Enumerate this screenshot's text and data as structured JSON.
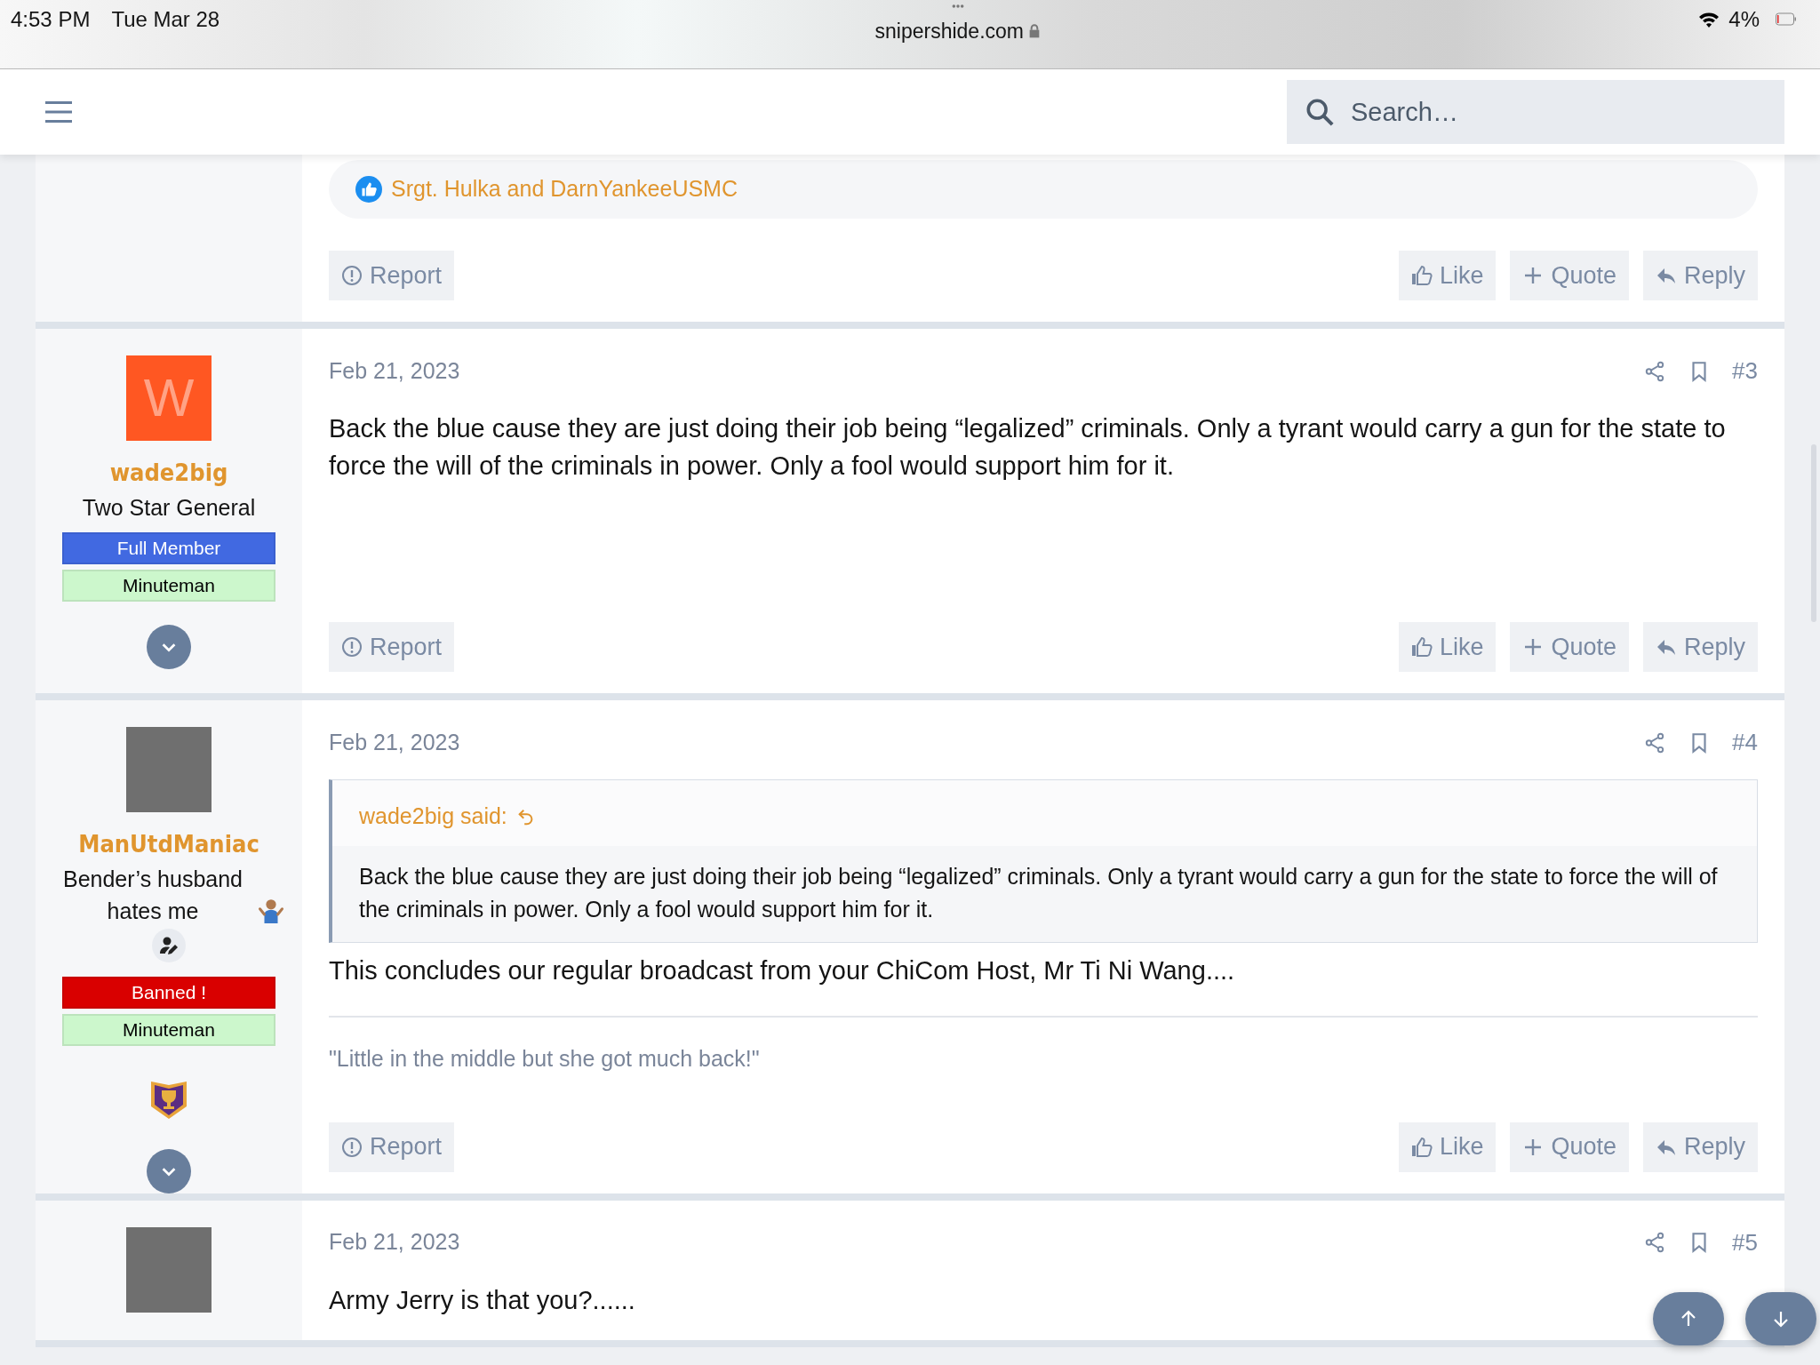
{
  "status_bar": {
    "time": "4:53 PM",
    "date": "Tue Mar 28",
    "url": "snipershide.com",
    "battery": "4%"
  },
  "navbar": {
    "search": {
      "placeholder": "Search…"
    }
  },
  "posts": [
    {
      "reactions": "Srgt. Hulka and DarnYankeeUSMC",
      "actions": [
        {
          "label": "Report",
          "kind": "report"
        },
        {
          "label": "Like",
          "kind": "like"
        },
        {
          "label": "Quote",
          "kind": "quote"
        },
        {
          "label": "Reply",
          "kind": "reply"
        }
      ]
    },
    {
      "user": {
        "avatar": {
          "kind": "letter",
          "letter": "W",
          "color": "#ff5722"
        },
        "name": "wade2big",
        "title": "Two Star General",
        "badges": [
          {
            "text": "Full Member",
            "color": "#4169e1"
          },
          {
            "text": "Minuteman",
            "color": "#ccf7cc"
          }
        ],
        "expand": true
      },
      "date": "Feb 21, 2023",
      "number": "#3",
      "body": "Back the blue cause they are just doing their job being “legalized” criminals. Only a tyrant would carry a gun for the state to force the will of the criminals in power. Only a fool would support him for it.",
      "actions": [
        {
          "label": "Report",
          "kind": "report"
        },
        {
          "label": "Like",
          "kind": "like"
        },
        {
          "label": "Quote",
          "kind": "quote"
        },
        {
          "label": "Reply",
          "kind": "reply"
        }
      ]
    },
    {
      "user": {
        "avatar": {
          "kind": "photo"
        },
        "name": "ManUtdManiac",
        "title": "Bender’s husband hates me",
        "title_emoji": true,
        "edit_icon": true,
        "badges": [
          {
            "text": "Banned !",
            "color": "#d90000"
          },
          {
            "text": "Minuteman",
            "color": "#ccf7cc"
          }
        ],
        "trophy": true,
        "expand": true
      },
      "date": "Feb 21, 2023",
      "number": "#4",
      "quote": {
        "author": "wade2big said:",
        "text": "Back the blue cause they are just doing their job being “legalized” criminals. Only a tyrant would carry a gun for the state to force the will of the criminals in power. Only a fool would support him for it."
      },
      "body": "This concludes our regular broadcast from your ChiCom Host, Mr Ti Ni Wang....",
      "signature": "\"Little in the middle but she got much back!\"",
      "actions": [
        {
          "label": "Report",
          "kind": "report"
        },
        {
          "label": "Like",
          "kind": "like"
        },
        {
          "label": "Quote",
          "kind": "quote"
        },
        {
          "label": "Reply",
          "kind": "reply"
        }
      ]
    },
    {
      "user": {
        "avatar": {
          "kind": "photo"
        }
      },
      "date": "Feb 21, 2023",
      "number": "#5",
      "body": "Army Jerry is that you?......"
    }
  ]
}
